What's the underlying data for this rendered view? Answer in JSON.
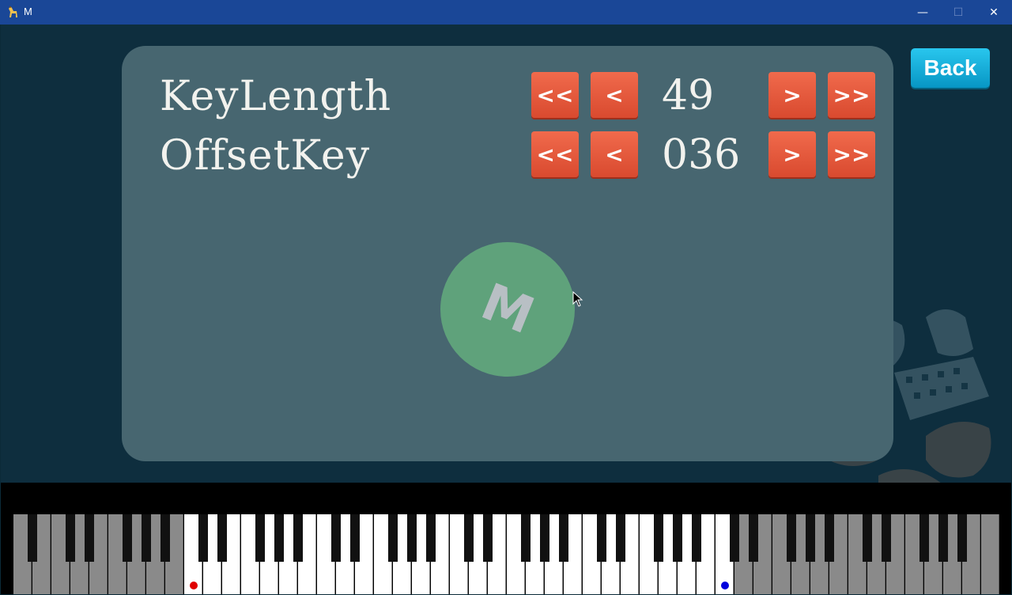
{
  "window": {
    "title": "M",
    "icon": "giraffe-icon",
    "controls": {
      "minimize": "—",
      "maximize": "☐",
      "close": "✕"
    }
  },
  "settings": {
    "rows": [
      {
        "label": "KeyLength",
        "value": "49",
        "buttons": {
          "dec_fast": "<<",
          "dec": "<",
          "inc": ">",
          "inc_fast": ">>"
        }
      },
      {
        "label": "OffsetKey",
        "value": "036",
        "buttons": {
          "dec_fast": "<<",
          "dec": "<",
          "inc": ">",
          "inc_fast": ">>"
        }
      }
    ]
  },
  "logo": {
    "letter": "M",
    "color": "#5fa27b"
  },
  "back_button": {
    "label": "Back",
    "color": "#1ab4e2"
  },
  "piano": {
    "white_key_count": 52,
    "active_start_white_index": 9,
    "active_white_key_count": 29,
    "start_marker_color": "#e00000",
    "end_marker_color": "#0000dd"
  },
  "colors": {
    "titlebar": "#1a4797",
    "panel": "#476670",
    "arrow_button": "#e85a3c",
    "background": "#0e2e3e"
  }
}
